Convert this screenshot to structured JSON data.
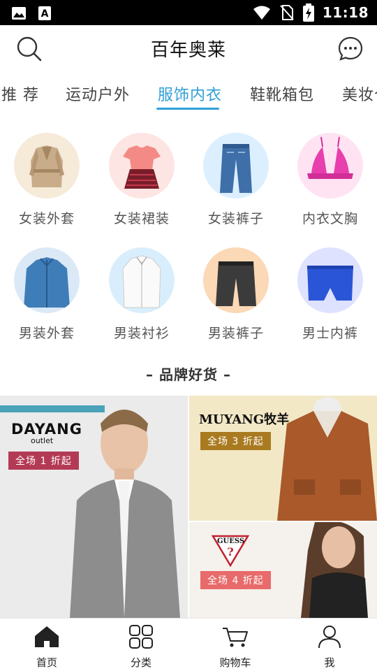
{
  "status_bar": {
    "time": "11:18",
    "icons": [
      "image-icon",
      "font-a-icon",
      "wifi-icon",
      "no-sim-icon",
      "battery-charging-icon"
    ]
  },
  "header": {
    "title": "百年奥莱",
    "left_icon": "search-icon",
    "right_icon": "message-icon"
  },
  "tabs": [
    {
      "label": "推 荐",
      "active": false
    },
    {
      "label": "运动户外",
      "active": false
    },
    {
      "label": "服饰内衣",
      "active": true
    },
    {
      "label": "鞋靴箱包",
      "active": false
    },
    {
      "label": "美妆个",
      "active": false
    }
  ],
  "categories": [
    {
      "label": "女装外套",
      "icon": "trench-coat-image"
    },
    {
      "label": "女装裙装",
      "icon": "dress-image"
    },
    {
      "label": "女装裤子",
      "icon": "jeans-image"
    },
    {
      "label": "内衣文胸",
      "icon": "bra-image"
    },
    {
      "label": "男装外套",
      "icon": "mens-jacket-image"
    },
    {
      "label": "男装衬衫",
      "icon": "shirt-image"
    },
    {
      "label": "男装裤子",
      "icon": "shorts-image"
    },
    {
      "label": "男士内裤",
      "icon": "briefs-image"
    }
  ],
  "brand_section": {
    "title": "– 品牌好货 –",
    "banners": [
      {
        "brand": "DAYANG",
        "sub": "outlet",
        "tag": "全场 1 折起",
        "tag_color": "#b33a55"
      },
      {
        "brand": "MUYANG",
        "brand_suffix": "牧羊",
        "tag": "全场 3 折起",
        "tag_color": "#a97a1f"
      },
      {
        "brand": "GUESS",
        "tag": "全场 4 折起",
        "tag_color": "#e86a6a"
      }
    ]
  },
  "bottom_nav": [
    {
      "label": "首页",
      "icon": "home-icon",
      "active": true
    },
    {
      "label": "分类",
      "icon": "grid-icon",
      "active": false
    },
    {
      "label": "购物车",
      "icon": "cart-icon",
      "active": false
    },
    {
      "label": "我",
      "icon": "user-icon",
      "active": false
    }
  ],
  "colors": {
    "accent": "#2f9fd8",
    "text_primary": "#111111",
    "text_secondary": "#555555"
  }
}
